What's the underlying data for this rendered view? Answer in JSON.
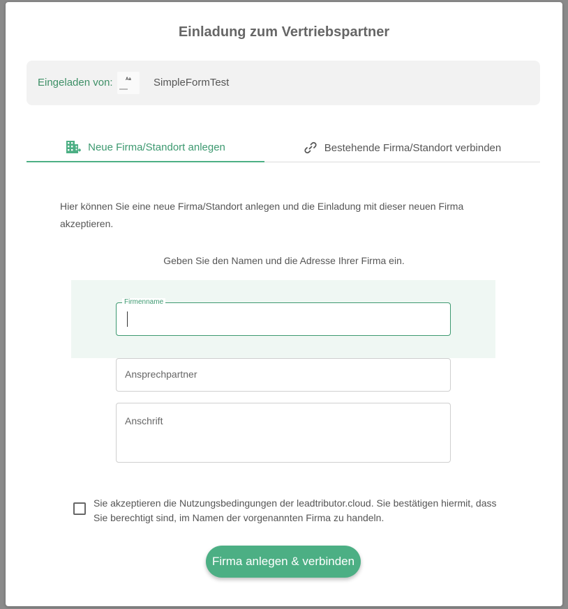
{
  "dialog": {
    "title": "Einladung zum Vertriebspartner"
  },
  "inviter": {
    "label": "Eingeladen von:",
    "logo_text": "Aa",
    "name": "SimpleFormTest"
  },
  "tabs": [
    {
      "label": "Neue Firma/Standort anlegen",
      "icon": "building-add-icon",
      "active": true
    },
    {
      "label": "Bestehende Firma/Standort verbinden",
      "icon": "link-icon",
      "active": false
    }
  ],
  "intro_text": "Hier können Sie eine neue Firma/Standort anlegen und die Einladung mit dieser neuen Firma akzeptieren.",
  "hint_text": "Geben Sie den Namen und die Adresse Ihrer Firma ein.",
  "form": {
    "company": {
      "label": "Firmenname",
      "value": ""
    },
    "contact": {
      "placeholder": "Ansprechpartner",
      "value": ""
    },
    "address": {
      "placeholder": "Anschrift",
      "value": ""
    }
  },
  "terms": {
    "checked": false,
    "text": "Sie akzeptieren die Nutzungsbedingungen der leadtributor.cloud. Sie bestätigen hiermit, dass Sie berechtigt sind, im Namen der vorgenannten Firma zu handeln."
  },
  "submit_label": "Firma anlegen & verbinden",
  "colors": {
    "accent": "#4caf84",
    "accent_text": "#3d9970",
    "focus_band": "#eff7f3",
    "inviter_bg": "#f2f2f2"
  }
}
